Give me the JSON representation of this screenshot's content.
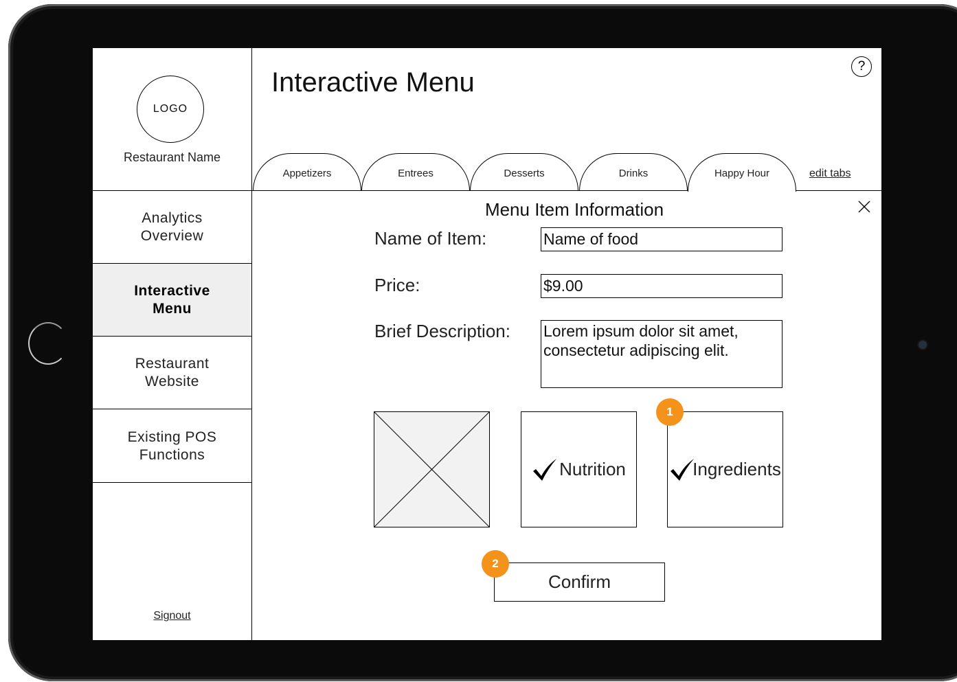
{
  "sidebar": {
    "logo_text": "LOGO",
    "restaurant_name": "Restaurant Name",
    "nav_items": [
      {
        "label": "Analytics\nOverview",
        "active": false
      },
      {
        "label": "Interactive\nMenu",
        "active": true
      },
      {
        "label": "Restaurant\nWebsite",
        "active": false
      },
      {
        "label": "Existing POS\nFunctions",
        "active": false
      }
    ],
    "signout_label": "Signout"
  },
  "header": {
    "title": "Interactive Menu",
    "help_label": "?",
    "tabs": [
      {
        "label": "Appetizers"
      },
      {
        "label": "Entrees"
      },
      {
        "label": "Desserts"
      },
      {
        "label": "Drinks"
      },
      {
        "label": "Happy Hour",
        "active": true
      }
    ],
    "edit_tabs_label": "edit tabs"
  },
  "form": {
    "title": "Menu Item Information",
    "name_label": "Name of Item:",
    "name_value": "Name of food",
    "price_label": "Price:",
    "price_value": "$9.00",
    "description_label": "Brief Description:",
    "description_value": "Lorem ipsum dolor sit amet, consectetur adipiscing elit.",
    "nutrition_label": "Nutrition",
    "nutrition_checked": true,
    "ingredients_label": "Ingredients",
    "ingredients_checked": true,
    "confirm_label": "Confirm"
  },
  "markers": [
    "1",
    "2"
  ],
  "icons": {
    "help": "question-icon",
    "close": "close-icon",
    "check": "checkmark-icon",
    "image": "image-placeholder-icon"
  },
  "colors": {
    "marker": "#f3931c",
    "active_nav_bg": "#efefef",
    "placeholder_bg": "#f2f2f2"
  }
}
